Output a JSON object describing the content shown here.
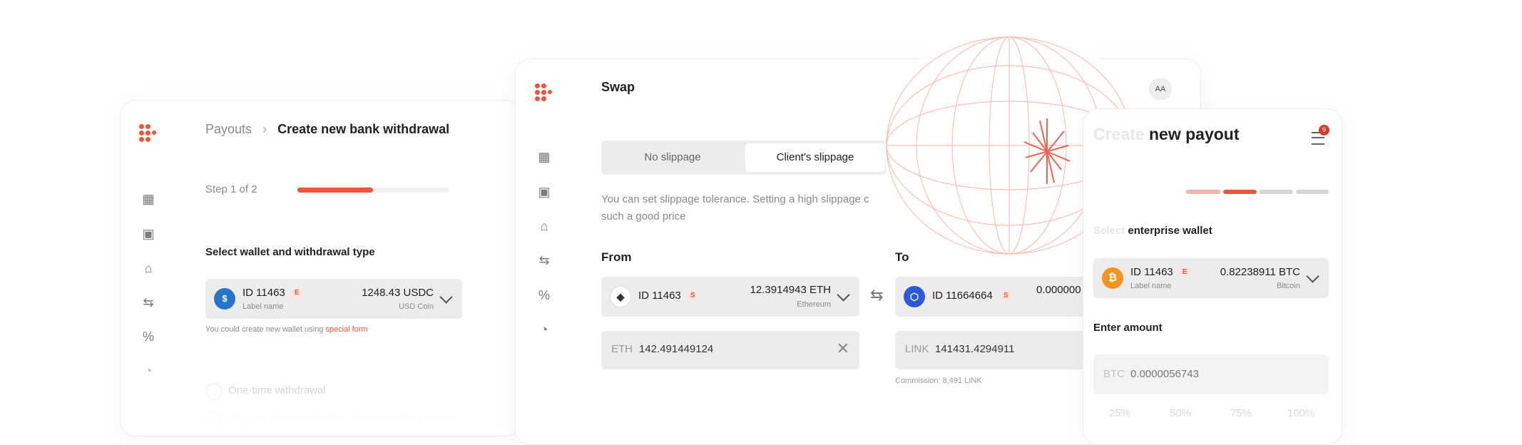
{
  "left": {
    "breadcrumb_root": "Payouts",
    "breadcrumb_sep": "›",
    "title": "Create new bank withdrawal",
    "step": "Step 1 of 2",
    "progress": 0.5,
    "section_title": "Select wallet and withdrawal type",
    "wallet": {
      "id": "ID 11463",
      "badge": "E",
      "label": "Label name",
      "amount": "1248.43 USDC",
      "coin": "USD Coin"
    },
    "hint_prefix": "You could create new wallet using ",
    "hint_link": "special form",
    "option1": "One-time withdrawal",
    "option2": "Regular withdrawal when the amount is reached"
  },
  "center": {
    "title": "Swap",
    "avatar": "AA",
    "tab_no_slippage": "No slippage",
    "tab_client_slippage": "Client's slippage",
    "desc_line1": "You can set slippage tolerance. Setting a high slippage c",
    "desc_line2": "such a good price",
    "from_label": "From",
    "to_label": "To",
    "from_wallet": {
      "id": "ID 11463",
      "badge": "S",
      "amount": "12.3914943 ETH",
      "coin": "Ethereum"
    },
    "to_wallet": {
      "id": "ID 11664664",
      "badge": "S",
      "amount": "0.000000"
    },
    "from_input": {
      "currency": "ETH",
      "value": "142.491449124"
    },
    "to_input": {
      "currency": "LINK",
      "value": "141431.4294911"
    },
    "commission": "Commission: 8,491 LINK"
  },
  "right": {
    "title_faded": "Create",
    "title": "new payout",
    "notif_count": "9",
    "progress_steps": [
      0.5,
      1,
      0,
      0
    ],
    "wallet_title_faded": "Select",
    "wallet_title": "enterprise wallet",
    "wallet": {
      "id": "ID 11463",
      "badge": "E",
      "label": "Label name",
      "amount": "0.82238911 BTC",
      "coin": "Bitcoin"
    },
    "amount_title": "Enter amount",
    "amount_input": {
      "currency": "BTC",
      "value": "0.0000056743"
    },
    "percents": [
      "25%",
      "50%",
      "75%",
      "100%"
    ]
  },
  "colors": {
    "accent": "#f0553a",
    "usdc": "#2775ca",
    "btc": "#f7931a",
    "link": "#2a5ada"
  }
}
